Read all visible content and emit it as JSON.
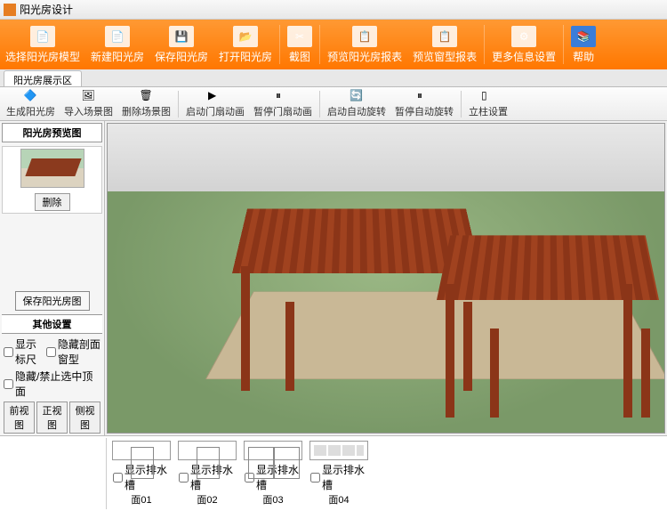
{
  "window": {
    "title": "阳光房设计"
  },
  "ribbon": [
    {
      "label": "选择阳光房模型"
    },
    {
      "label": "新建阳光房"
    },
    {
      "label": "保存阳光房"
    },
    {
      "label": "打开阳光房"
    },
    {
      "label": "截图"
    },
    {
      "label": "预览阳光房报表"
    },
    {
      "label": "预览窗型报表"
    },
    {
      "label": "更多信息设置"
    },
    {
      "label": "帮助"
    }
  ],
  "tab": {
    "label": "阳光房展示区"
  },
  "toolbar2": [
    {
      "label": "生成阳光房"
    },
    {
      "label": "导入场景图"
    },
    {
      "label": "删除场景图"
    },
    {
      "label": "启动门扇动画"
    },
    {
      "label": "暂停门扇动画"
    },
    {
      "label": "启动自动旋转"
    },
    {
      "label": "暂停自动旋转"
    },
    {
      "label": "立柱设置"
    }
  ],
  "sidebar": {
    "preview_title": "阳光房预览图",
    "delete_btn": "删除",
    "save_btn": "保存阳光房图",
    "other_title": "其他设置",
    "chk_ruler": "显示标尺",
    "chk_hide_section": "隐藏剖面窗型",
    "chk_hide_selected": "隐藏/禁止选中顶面",
    "btn_front": "前视图",
    "btn_ortho": "正视图",
    "btn_side": "侧视图"
  },
  "faces": [
    {
      "chk": "显示排水槽",
      "label": "面01",
      "type": "door"
    },
    {
      "chk": "显示排水槽",
      "label": "面02",
      "type": "door"
    },
    {
      "chk": "显示排水槽",
      "label": "面03",
      "type": "window"
    },
    {
      "chk": "显示排水槽",
      "label": "面04",
      "type": "panel"
    }
  ]
}
